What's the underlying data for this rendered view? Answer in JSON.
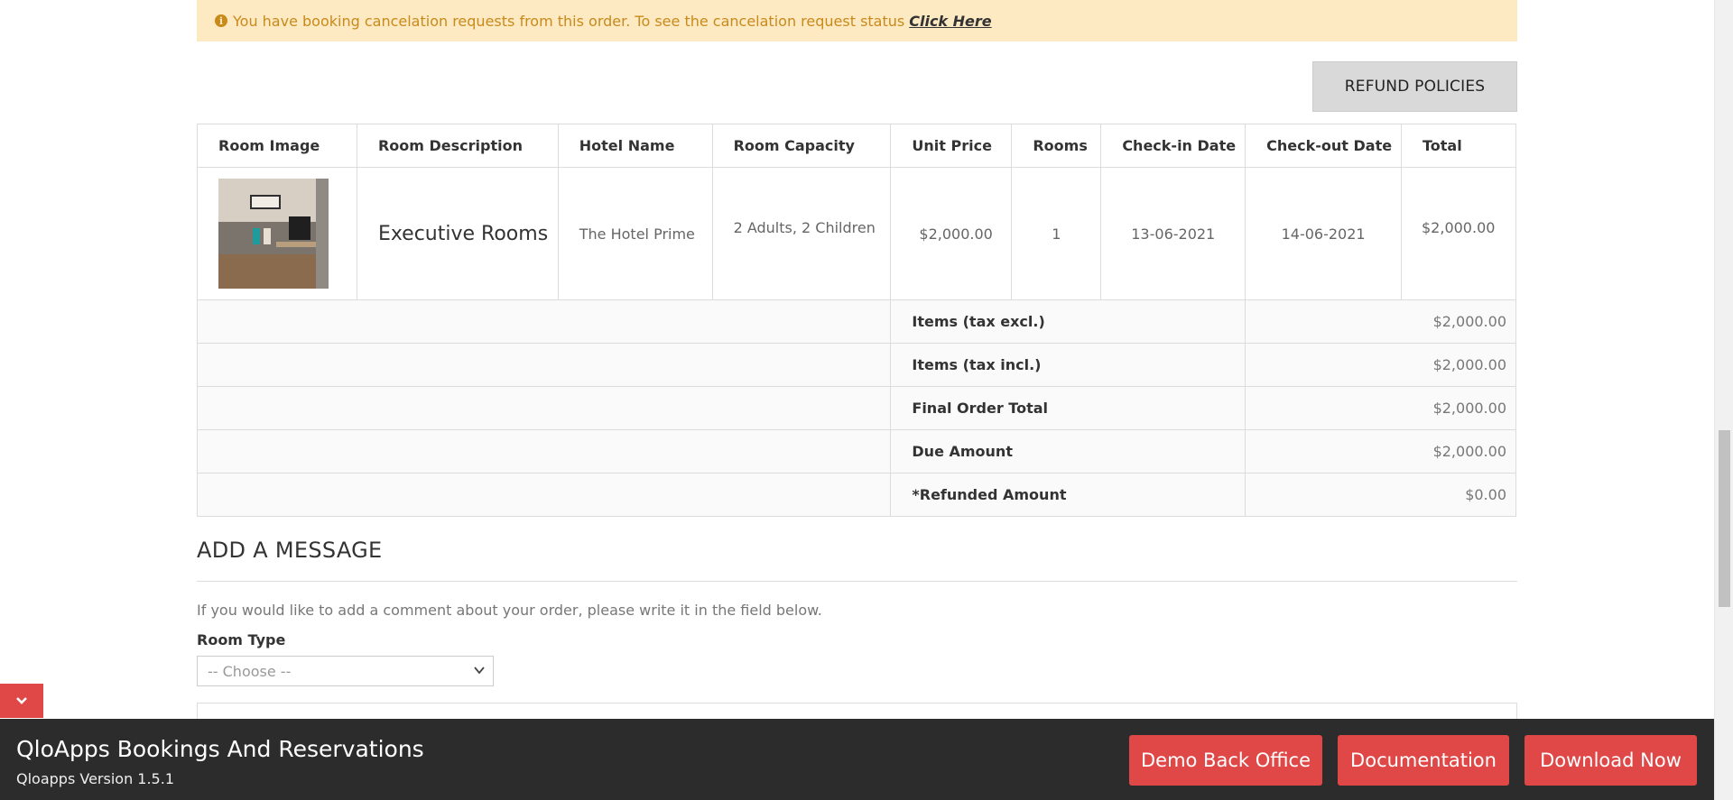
{
  "alert": {
    "text": "You have booking cancelation requests from this order. To see the cancelation request status",
    "link_label": "Click Here",
    "icon": "info-circle-icon",
    "color": "#c88a1b"
  },
  "refund_button_label": "REFUND POLICIES",
  "table": {
    "headers": [
      "Room Image",
      "Room Description",
      "Hotel Name",
      "Room Capacity",
      "Unit Price",
      "Rooms",
      "Check-in Date",
      "Check-out Date",
      "Total"
    ],
    "row": {
      "room_description": "Executive Rooms",
      "hotel_name": "The Hotel Prime",
      "room_capacity": "2 Adults, 2 Children",
      "unit_price": "$2,000.00",
      "rooms": "1",
      "check_in": "13-06-2021",
      "check_out": "14-06-2021",
      "total": "$2,000.00"
    },
    "totals": [
      {
        "label": "Items (tax excl.)",
        "value": "$2,000.00"
      },
      {
        "label": "Items (tax incl.)",
        "value": "$2,000.00"
      },
      {
        "label": "Final Order Total",
        "value": "$2,000.00"
      },
      {
        "label": "Due Amount",
        "value": "$2,000.00"
      },
      {
        "label": "*Refunded Amount",
        "value": "$0.00"
      }
    ]
  },
  "message": {
    "heading": "ADD A MESSAGE",
    "help": "If you would like to add a comment about your order, please write it in the field below.",
    "room_type_label": "Room Type",
    "room_type_selected": "-- Choose --"
  },
  "footer": {
    "title": "QloApps Bookings And Reservations",
    "version": "Qloapps Version 1.5.1",
    "demo_label": "Demo Back Office",
    "docs_label": "Documentation",
    "download_label": "Download Now",
    "accent_color": "#e04848"
  }
}
